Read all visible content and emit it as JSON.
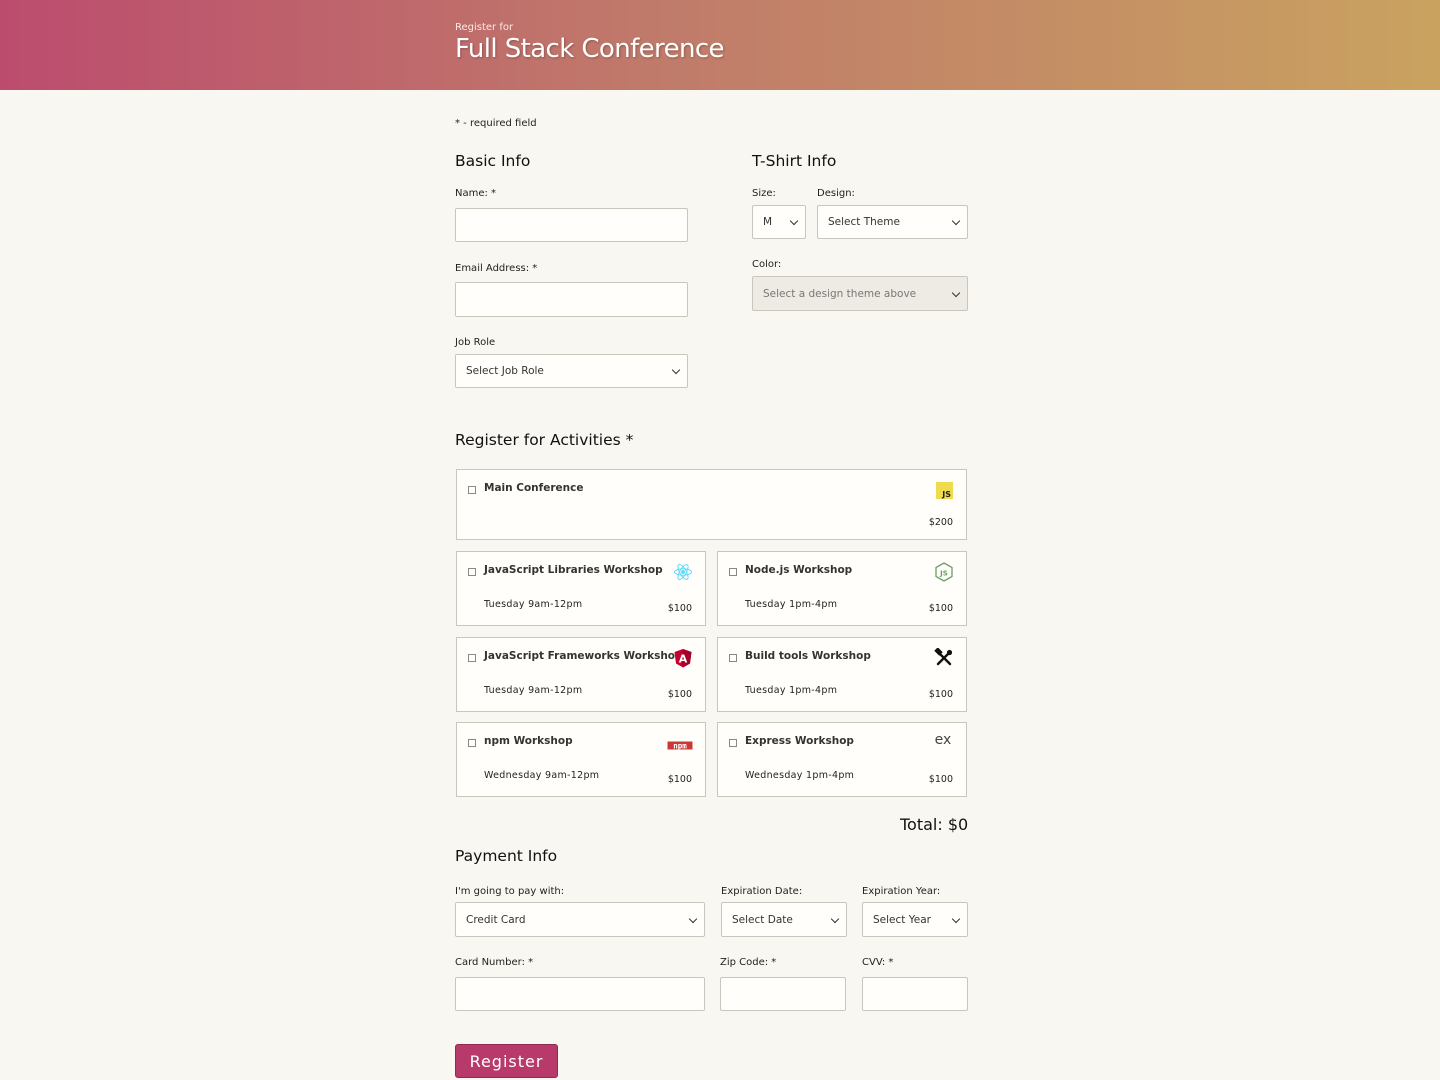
{
  "header": {
    "subtitle": "Register for",
    "title": "Full Stack Conference"
  },
  "required_note": "* - required field",
  "basic_info": {
    "heading": "Basic Info",
    "name_label": "Name: *",
    "email_label": "Email Address: *",
    "job_role_label": "Job Role",
    "job_role_value": "Select Job Role"
  },
  "tshirt": {
    "heading": "T-Shirt Info",
    "size_label": "Size:",
    "size_value": "M",
    "design_label": "Design:",
    "design_value": "Select Theme",
    "color_label": "Color:",
    "color_value": "Select a design theme above"
  },
  "activities": {
    "heading": "Register for Activities *",
    "main": {
      "name": "Main Conference",
      "price": "$200",
      "icon": "js-icon"
    },
    "workshops": [
      {
        "name": "JavaScript Libraries Workshop",
        "time": "Tuesday 9am-12pm",
        "price": "$100",
        "icon": "react-icon"
      },
      {
        "name": "Node.js Workshop",
        "time": "Tuesday 1pm-4pm",
        "price": "$100",
        "icon": "nodejs-icon"
      },
      {
        "name": "JavaScript Frameworks Workshop",
        "time": "Tuesday 9am-12pm",
        "price": "$100",
        "icon": "angular-icon"
      },
      {
        "name": "Build tools Workshop",
        "time": "Tuesday 1pm-4pm",
        "price": "$100",
        "icon": "tools-icon"
      },
      {
        "name": "npm Workshop",
        "time": "Wednesday 9am-12pm",
        "price": "$100",
        "icon": "npm-icon"
      },
      {
        "name": "Express Workshop",
        "time": "Wednesday 1pm-4pm",
        "price": "$100",
        "icon": "express-icon"
      }
    ],
    "total": "Total: $0"
  },
  "payment": {
    "heading": "Payment Info",
    "pay_with_label": "I'm going to pay with:",
    "pay_with_value": "Credit Card",
    "exp_date_label": "Expiration Date:",
    "exp_date_value": "Select Date",
    "exp_year_label": "Expiration Year:",
    "exp_year_value": "Select Year",
    "card_number_label": "Card Number: *",
    "zip_label": "Zip Code: *",
    "cvv_label": "CVV: *"
  },
  "register_button": "Register",
  "colors": {
    "header_start": "#bc4c6e",
    "header_end": "#c9a260",
    "button": "#b83a6b",
    "background": "#f9f7f1"
  }
}
